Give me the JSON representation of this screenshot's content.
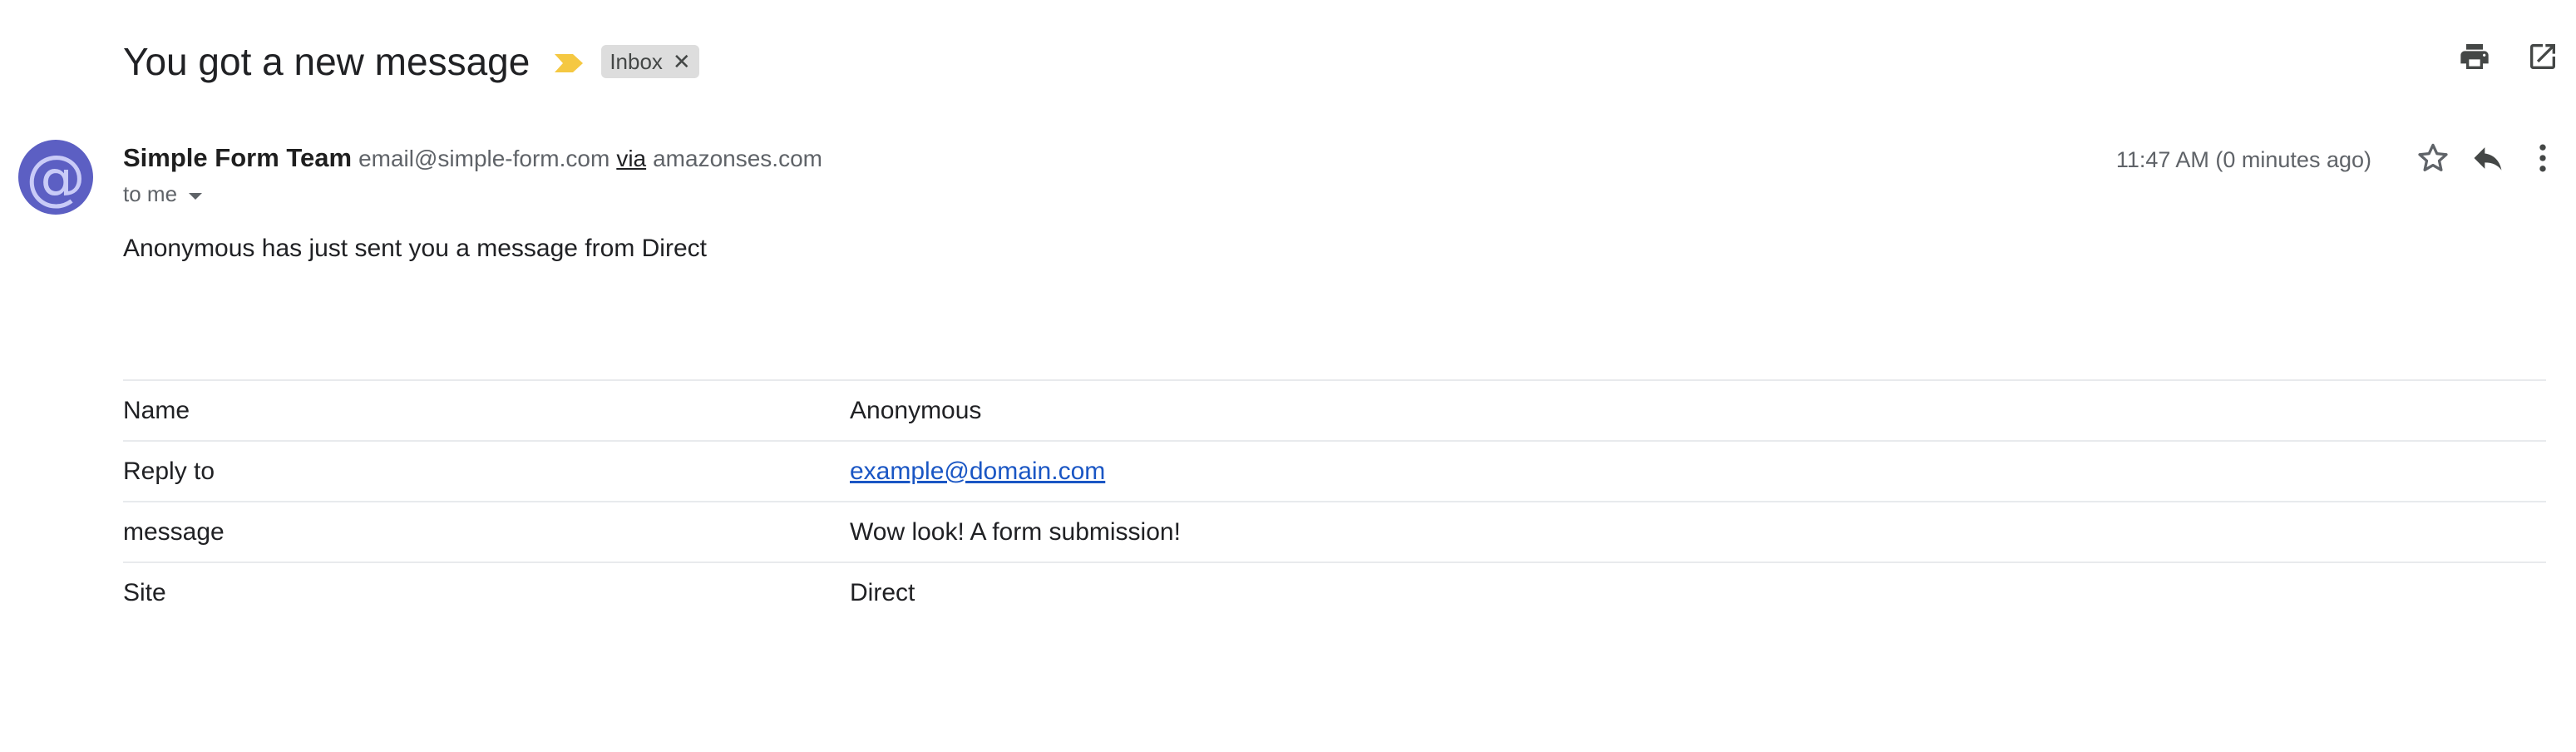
{
  "email": {
    "subject": "You got a new message",
    "label": "Inbox",
    "sender": {
      "name": "Simple Form Team",
      "email": "email@simple-form.com",
      "via_text": "via",
      "via_domain": "amazonses.com",
      "avatar_glyph": "@",
      "avatar_color": "#5c5fc3"
    },
    "recipient": "to me",
    "timestamp": "11:47 AM (0 minutes ago)",
    "intro": "Anonymous has just sent you a message from Direct",
    "fields": [
      {
        "label": "Name",
        "value": "Anonymous"
      },
      {
        "label": "Reply to",
        "value": "example@domain.com"
      },
      {
        "label": "message",
        "value": "Wow look! A form submission!"
      },
      {
        "label": "Site",
        "value": "Direct"
      }
    ]
  },
  "icons": {
    "importance": "importance-marker-icon",
    "label_close": "close-icon",
    "print": "print-icon",
    "open_new_window": "open-in-new-window-icon",
    "star": "star-icon",
    "reply": "reply-icon",
    "more": "more-vert-icon"
  },
  "colors": {
    "importance_marker": "#f5c842",
    "link": "#1a56c4",
    "chip_bg": "#dddddd"
  }
}
